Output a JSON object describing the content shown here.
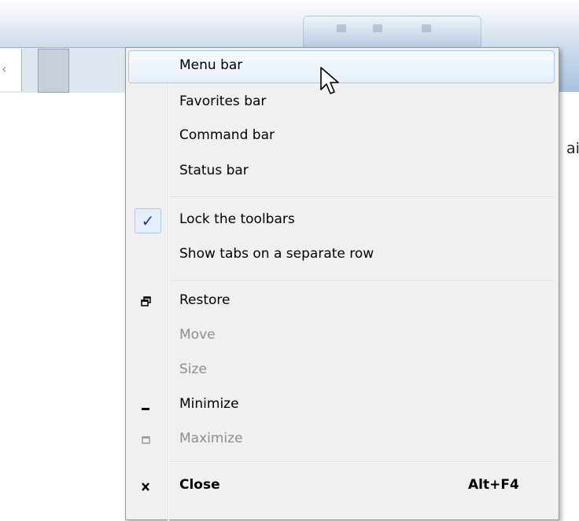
{
  "window": {
    "tab_fragment": "‹",
    "content_fragment": "ail"
  },
  "menu": {
    "items": [
      {
        "label": "Menu bar"
      },
      {
        "label": "Favorites bar"
      },
      {
        "label": "Command bar"
      },
      {
        "label": "Status bar"
      },
      {
        "label": "Lock the toolbars",
        "checked": true,
        "check_glyph": "✓"
      },
      {
        "label": "Show tabs on a separate row"
      },
      {
        "label": "Restore",
        "icon": "restore-icon"
      },
      {
        "label": "Move",
        "disabled": true
      },
      {
        "label": "Size",
        "disabled": true
      },
      {
        "label": "Minimize",
        "icon": "minimize-icon"
      },
      {
        "label": "Maximize",
        "icon": "maximize-icon",
        "disabled": true
      },
      {
        "label": "Close",
        "icon": "close-icon",
        "shortcut": "Alt+F4",
        "bold": true
      }
    ],
    "hovered_item": "Menu bar"
  },
  "colors": {
    "menu_background": "#f0f0f0",
    "hover_border": "#a8c8ec",
    "check_color": "#1a3e9f",
    "disabled_text": "#8d8d8d"
  }
}
